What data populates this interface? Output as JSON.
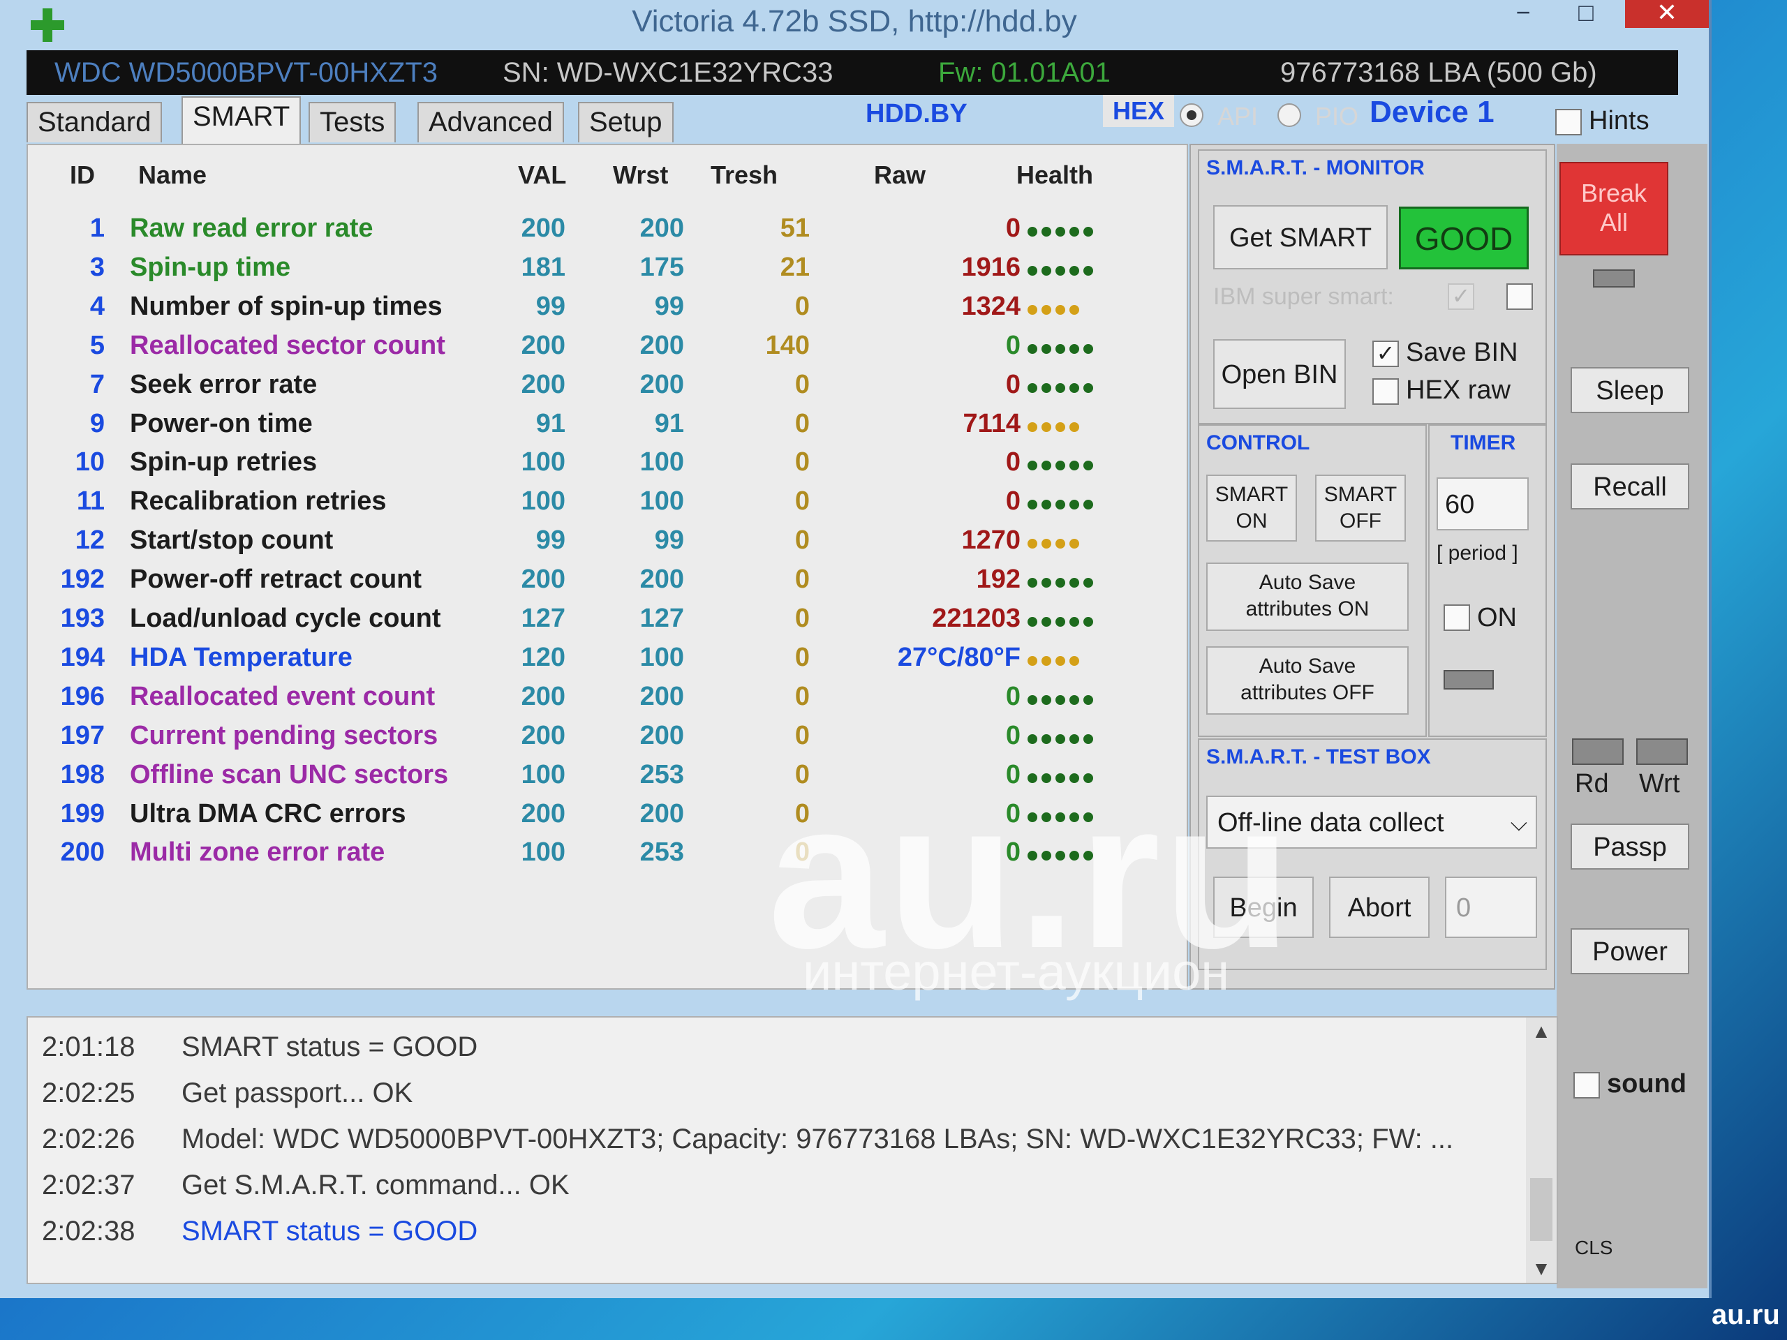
{
  "window": {
    "title": "Victoria 4.72b SSD, http://hdd.by",
    "minimize": "−",
    "maximize": "□",
    "close": "✕"
  },
  "info": {
    "model": "WDC WD5000BPVT-00HXZT3",
    "serial": "SN: WD-WXC1E32YRC33",
    "firmware": "Fw: 01.01A01",
    "lba": "976773168 LBA (500 Gb)"
  },
  "tabs": [
    "Standard",
    "SMART",
    "Tests",
    "Advanced",
    "Setup"
  ],
  "active_tab": "SMART",
  "header": {
    "link": "HDD.BY",
    "hex": "HEX",
    "api": "API",
    "pio": "PIO",
    "device": "Device 1",
    "hints": "Hints"
  },
  "table": {
    "columns": [
      "ID",
      "Name",
      "VAL",
      "Wrst",
      "Tresh",
      "Raw",
      "Health"
    ],
    "rows": [
      {
        "id": "1",
        "name": "Raw read error rate",
        "val": "200",
        "wrst": "200",
        "tresh": "51",
        "raw": "0",
        "health": 5,
        "name_color": "#2a8a2a",
        "raw_color": "#a01818",
        "health_color": "#1d6b1d"
      },
      {
        "id": "3",
        "name": "Spin-up time",
        "val": "181",
        "wrst": "175",
        "tresh": "21",
        "raw": "1916",
        "health": 5,
        "name_color": "#2a8a2a",
        "raw_color": "#a01818",
        "health_color": "#1d6b1d"
      },
      {
        "id": "4",
        "name": "Number of spin-up times",
        "val": "99",
        "wrst": "99",
        "tresh": "0",
        "raw": "1324",
        "health": 4,
        "name_color": "#1c1c1c",
        "raw_color": "#a01818",
        "health_color": "#d4a017"
      },
      {
        "id": "5",
        "name": "Reallocated sector count",
        "val": "200",
        "wrst": "200",
        "tresh": "140",
        "raw": "0",
        "health": 5,
        "name_color": "#9b2aa6",
        "raw_color": "#2a8a2a",
        "health_color": "#1d6b1d"
      },
      {
        "id": "7",
        "name": "Seek error rate",
        "val": "200",
        "wrst": "200",
        "tresh": "0",
        "raw": "0",
        "health": 5,
        "name_color": "#1c1c1c",
        "raw_color": "#a01818",
        "health_color": "#1d6b1d"
      },
      {
        "id": "9",
        "name": "Power-on time",
        "val": "91",
        "wrst": "91",
        "tresh": "0",
        "raw": "7114",
        "health": 4,
        "name_color": "#1c1c1c",
        "raw_color": "#a01818",
        "health_color": "#d4a017"
      },
      {
        "id": "10",
        "name": "Spin-up retries",
        "val": "100",
        "wrst": "100",
        "tresh": "0",
        "raw": "0",
        "health": 5,
        "name_color": "#1c1c1c",
        "raw_color": "#a01818",
        "health_color": "#1d6b1d"
      },
      {
        "id": "11",
        "name": "Recalibration retries",
        "val": "100",
        "wrst": "100",
        "tresh": "0",
        "raw": "0",
        "health": 5,
        "name_color": "#1c1c1c",
        "raw_color": "#a01818",
        "health_color": "#1d6b1d"
      },
      {
        "id": "12",
        "name": "Start/stop count",
        "val": "99",
        "wrst": "99",
        "tresh": "0",
        "raw": "1270",
        "health": 4,
        "name_color": "#1c1c1c",
        "raw_color": "#a01818",
        "health_color": "#d4a017"
      },
      {
        "id": "192",
        "name": "Power-off retract count",
        "val": "200",
        "wrst": "200",
        "tresh": "0",
        "raw": "192",
        "health": 5,
        "name_color": "#1c1c1c",
        "raw_color": "#a01818",
        "health_color": "#1d6b1d"
      },
      {
        "id": "193",
        "name": "Load/unload cycle count",
        "val": "127",
        "wrst": "127",
        "tresh": "0",
        "raw": "221203",
        "health": 5,
        "name_color": "#1c1c1c",
        "raw_color": "#a01818",
        "health_color": "#1d6b1d"
      },
      {
        "id": "194",
        "name": "HDA Temperature",
        "val": "120",
        "wrst": "100",
        "tresh": "0",
        "raw": "27°C/80°F",
        "health": 4,
        "name_color": "#1a4ae0",
        "raw_color": "#1a4ae0",
        "health_color": "#d4a017"
      },
      {
        "id": "196",
        "name": "Reallocated event count",
        "val": "200",
        "wrst": "200",
        "tresh": "0",
        "raw": "0",
        "health": 5,
        "name_color": "#9b2aa6",
        "raw_color": "#2a8a2a",
        "health_color": "#1d6b1d"
      },
      {
        "id": "197",
        "name": "Current pending sectors",
        "val": "200",
        "wrst": "200",
        "tresh": "0",
        "raw": "0",
        "health": 5,
        "name_color": "#9b2aa6",
        "raw_color": "#2a8a2a",
        "health_color": "#1d6b1d"
      },
      {
        "id": "198",
        "name": "Offline scan UNC sectors",
        "val": "100",
        "wrst": "253",
        "tresh": "0",
        "raw": "0",
        "health": 5,
        "name_color": "#9b2aa6",
        "raw_color": "#2a8a2a",
        "health_color": "#1d6b1d"
      },
      {
        "id": "199",
        "name": "Ultra DMA CRC errors",
        "val": "200",
        "wrst": "200",
        "tresh": "0",
        "raw": "0",
        "health": 5,
        "name_color": "#1c1c1c",
        "raw_color": "#2a8a2a",
        "health_color": "#1d6b1d"
      },
      {
        "id": "200",
        "name": "Multi zone error rate",
        "val": "100",
        "wrst": "253",
        "tresh": "0",
        "raw": "0",
        "health": 5,
        "name_color": "#9b2aa6",
        "raw_color": "#2a8a2a",
        "health_color": "#1d6b1d"
      }
    ]
  },
  "monitor": {
    "title": "S.M.A.R.T. - MONITOR",
    "get_smart": "Get SMART",
    "status": "GOOD",
    "ibm_super_smart": "IBM super smart:",
    "open_bin": "Open BIN",
    "save_bin": "Save BIN",
    "hex_raw": "HEX raw"
  },
  "control": {
    "title": "CONTROL",
    "smart_on_1": "SMART",
    "smart_on_2": "ON",
    "smart_off_1": "SMART",
    "smart_off_2": "OFF",
    "auto_on_1": "Auto Save",
    "auto_on_2": "attributes ON",
    "auto_off_1": "Auto Save",
    "auto_off_2": "attributes OFF"
  },
  "timer": {
    "title": "TIMER",
    "value": "60",
    "period": "[ period ]",
    "on": "ON"
  },
  "testbox": {
    "title": "S.M.A.R.T. - TEST BOX",
    "selected": "Off-line data collect",
    "begin": "Begin",
    "abort": "Abort",
    "count": "0"
  },
  "right": {
    "break_1": "Break",
    "break_2": "All",
    "sleep": "Sleep",
    "recall": "Recall",
    "rd": "Rd",
    "wrt": "Wrt",
    "passp": "Passp",
    "power": "Power",
    "sound": "sound",
    "cls": "CLS"
  },
  "log": [
    {
      "time": "2:01:18",
      "msg": "SMART status = GOOD",
      "color": "#3a3a3a"
    },
    {
      "time": "2:02:25",
      "msg": "Get passport... OK",
      "color": "#3a3a3a"
    },
    {
      "time": "2:02:26",
      "msg": "Model: WDC WD5000BPVT-00HXZT3; Capacity: 976773168 LBAs; SN: WD-WXC1E32YRC33; FW: ...",
      "color": "#3a3a3a"
    },
    {
      "time": "2:02:37",
      "msg": "Get S.M.A.R.T. command... OK",
      "color": "#3a3a3a"
    },
    {
      "time": "2:02:38",
      "msg": "SMART status = GOOD",
      "color": "#1a4ae0"
    }
  ],
  "watermark": {
    "main": "au.ru",
    "sub": "интернет-аукцион",
    "corner": "au.ru"
  }
}
